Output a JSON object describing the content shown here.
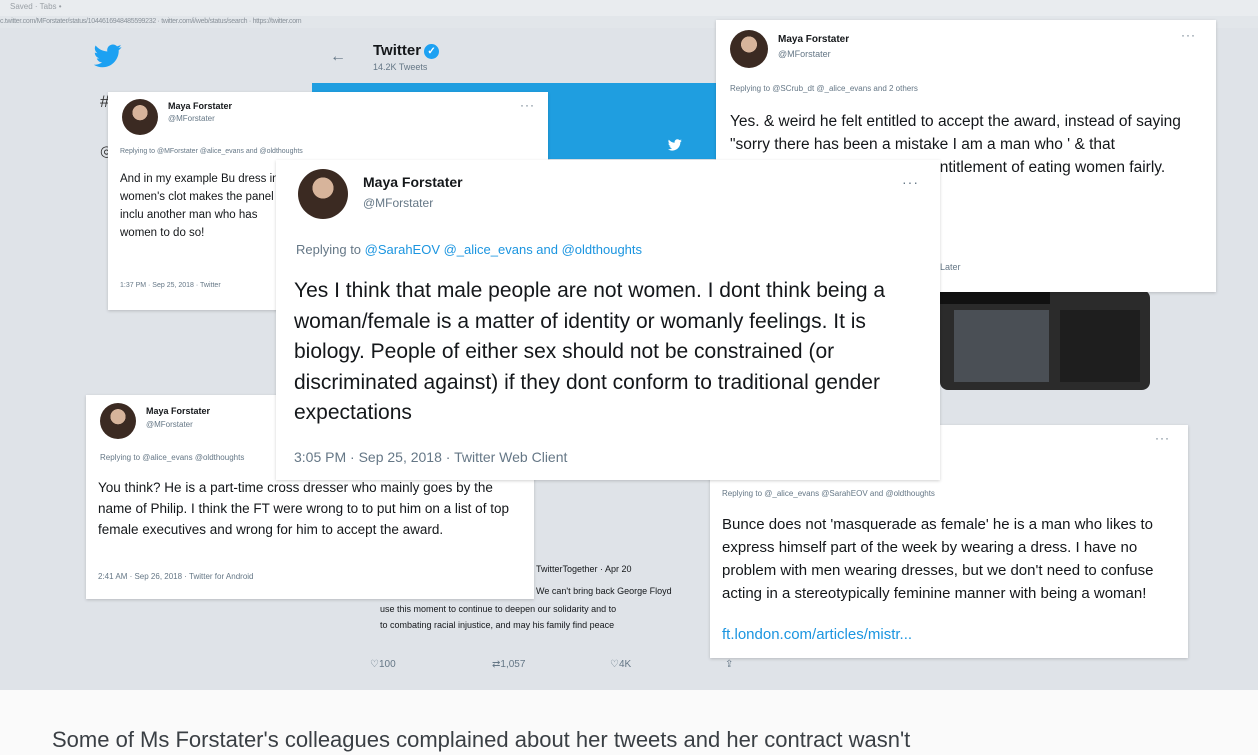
{
  "browser": {
    "tab_text": "Saved · Tabs  •",
    "url_text": "c.twitter.com/MForstater/status/1044616948485599232 · twitter.com/i/web/status/search · https://twitter.com"
  },
  "twitter_header": {
    "title": "Twitter",
    "tweet_count": "14.2K Tweets"
  },
  "main_tweet": {
    "name": "Maya Forstater",
    "handle": "@MForstater",
    "replying_prefix": "Replying to ",
    "replying_to": "@SarahEOV @_alice_evans and @oldthoughts",
    "text": "Yes I think that male people are not women. I dont think being a woman/female is a matter of identity or womanly feelings. It is biology. People of either sex should not be constrained (or discriminated against) if they dont conform to traditional gender expectations",
    "timestamp": "3:05 PM · Sep 25, 2018 · Twitter Web Client"
  },
  "tweet_top_left": {
    "name": "Maya Forstater",
    "handle": "@MForstater",
    "replying": "Replying to @MForstater @alice_evans and @oldthoughts",
    "text": "And in my example Bu dress in women's clot makes the panel inclu another man who has women to do so!",
    "timestamp": "1:37 PM · Sep 25, 2018 · Twitter"
  },
  "tweet_top_right": {
    "name": "Maya Forstater",
    "handle": "@MForstater",
    "replying": "Replying to @SCrub_dt @_alice_evans and 2 others",
    "text": "Yes. & weird he felt entitled to accept the award, instead of saying \"sorry there has been a mistake I am a man who ' & that CreditSuisse didn't utting the entitlement of eating women fairly.",
    "meta": "Later",
    "dots": "···"
  },
  "tweet_bottom_left": {
    "name": "Maya Forstater",
    "handle": "@MForstater",
    "replying": "Replying to @alice_evans @oldthoughts",
    "text": "You think? He is a part-time cross dresser who mainly goes by the name of Philip. I think the FT were wrong to to put him on a list of top female executives and wrong for him to accept the award.",
    "timestamp": "2:41 AM · Sep 26, 2018 · Twitter for Android"
  },
  "tweet_bottom_right": {
    "replying": "Replying to @_alice_evans @SarahEOV and @oldthoughts",
    "text": "Bunce does not 'masquerade as female' he is a man who likes to express himself part of the week by wearing a dress. I have no problem with men wearing dresses, but we don't need to confuse acting in a stereotypically feminine manner with being a woman!",
    "link": "ft.london.com/articles/mistr...",
    "dots": "···"
  },
  "background_tweet": {
    "header": "TwitterTogether · Apr 20",
    "line1": "We can't bring back George Floyd",
    "line2": "use this moment to continue to deepen our solidarity and to",
    "line3": "to combating racial injustice, and may his family find peace",
    "reply_count": "100",
    "retweet_count": "1,057",
    "like_count": "4K"
  },
  "caption": "Some of Ms Forstater's colleagues complained about her tweets and her contract wasn't"
}
